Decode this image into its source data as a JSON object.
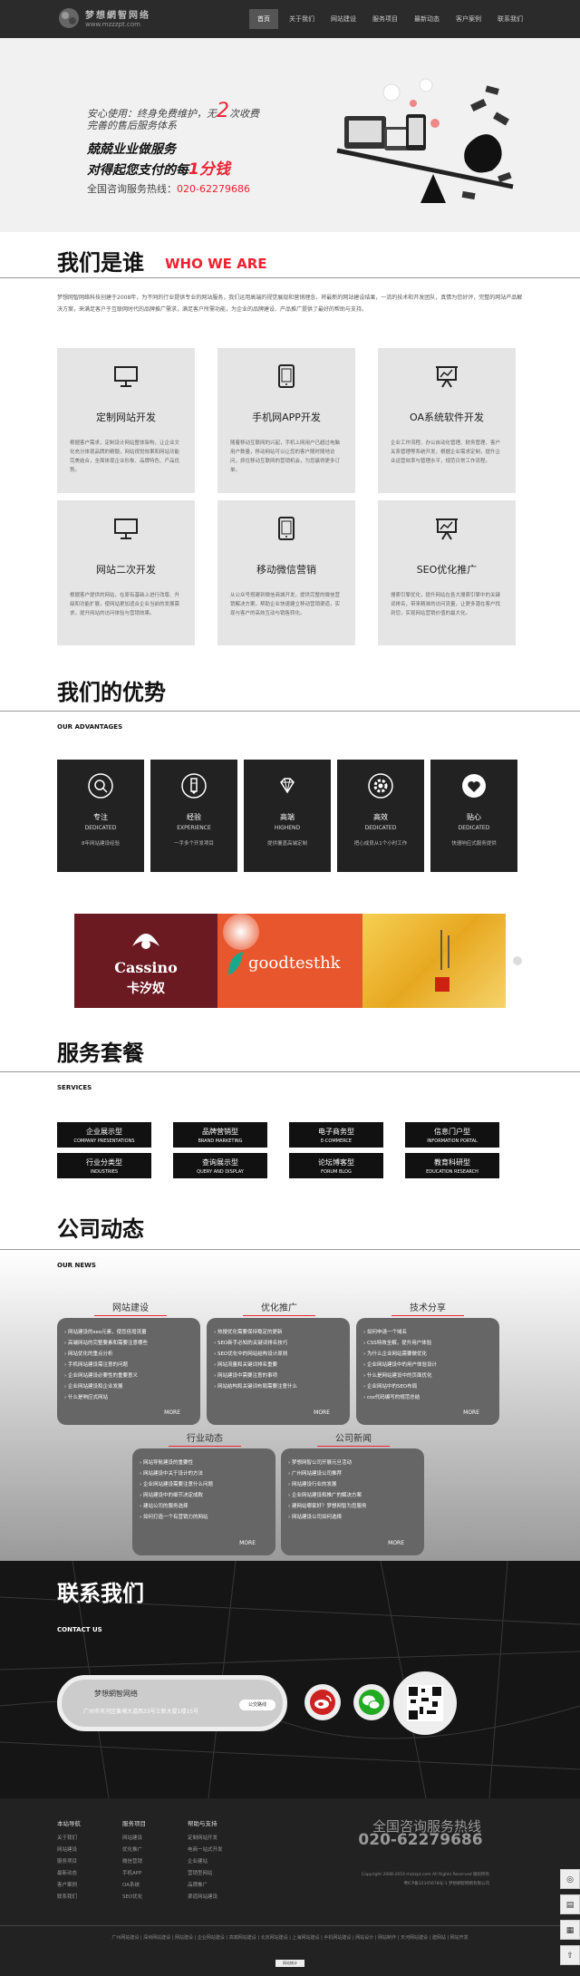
{
  "header": {
    "logo_name": "梦想網智网络",
    "logo_url": "www.mzzzpt.com",
    "nav": [
      "首页",
      "关于我们",
      "网站建设",
      "服务项目",
      "最新动态",
      "客户案例",
      "联系我们"
    ]
  },
  "banner": {
    "line1_a": "安心使用：终身免费维护，无",
    "line1_num": "2",
    "line1_b": "次收费",
    "line2": "完善的售后服务体系",
    "line3": "兢兢业业做服务",
    "line4_a": "对得起您支付的每",
    "line4_b": "1分钱",
    "line5_a": "全国咨询服务热线：",
    "line5_b": "020-62279686"
  },
  "about": {
    "title": "我们是谁",
    "title_en": "WHO WE ARE",
    "intro": "梦想网智网络科技创建于2008年，为不同的行业提供专业的网站服务，我们运用高端的视觉展现和营销理念，将最新的网站建设结果，一流的技术和开发团队，真情为您好评，完整的网站产品解决方案，来满足客户于互联网时代的品牌推广需求，满足客户所需功能，为企业的品牌建设、产品推广提供了最好的帮助与支持。"
  },
  "services": [
    {
      "title": "定制网站开发",
      "icon": "monitor-icon",
      "desc": "根据客户需求，定制设计网站整体架构，让企业文化充分体现品牌的精髓，网站视觉效果和网站功能完美结合，全面体现企业形象、品牌特色、产品优势。"
    },
    {
      "title": "手机网APP开发",
      "icon": "tablet-icon",
      "desc": "随着移动互联网的兴起，手机上网用户已超过电脑用户数量，移动网站可以让您的客户随时随地访问，抓住移动互联网的营销机会，为您赢得更多订单。"
    },
    {
      "title": "OA系统软件开发",
      "icon": "presentation-icon",
      "desc": "企业工作流程、办公自动化管理、财务管理、客户关系管理等系统开发，根据企业需求定制，提升企业运营效率与管理水平，规范日常工作流程。"
    },
    {
      "title": "网站二次开发",
      "icon": "monitor-icon",
      "desc": "根据客户提供的网站，在原有基础上进行改版、升级和功能扩展，使网站更加适合企业当前的发展需求，提升网站的访问体验与营销效果。"
    },
    {
      "title": "移动微信营销",
      "icon": "tablet-icon",
      "desc": "从公众号搭建到微信商城开发，提供完整的微信营销解决方案，帮助企业快速建立移动营销渠道，实现与客户的高效互动与销售转化。"
    },
    {
      "title": "SEO优化推广",
      "icon": "presentation-icon",
      "desc": "搜索引擎优化，提升网站在各大搜索引擎中的关键词排名，带来精准的访问流量，让更多潜在客户找到您，实现网站营销价值的最大化。"
    }
  ],
  "advantages": {
    "title": "我们的优势",
    "subtitle": "OUR ADVANTAGES",
    "items": [
      {
        "cn": "专注",
        "en": "DEDICATED",
        "desc": "8年网站建设经验",
        "icon": "search-icon"
      },
      {
        "cn": "经验",
        "en": "EXPERIENCE",
        "desc": "一手多个开发项目",
        "icon": "pen-icon"
      },
      {
        "cn": "高端",
        "en": "HIGHEND",
        "desc": "提供覆盖高端定制",
        "icon": "diamond-icon"
      },
      {
        "cn": "高效",
        "en": "DEDICATED",
        "desc": "把心成员从1个小时工作",
        "icon": "gear-icon"
      },
      {
        "cn": "贴心",
        "en": "DEDICATED",
        "desc": "快速响应式服务提供",
        "icon": "heart-icon"
      }
    ]
  },
  "cases": {
    "case1_name": "Cassino",
    "case1_cn": "卡汐奴",
    "case2_name": "goodtesthk"
  },
  "packages": {
    "title": "服务套餐",
    "subtitle": "SERVICES",
    "items": [
      {
        "cn": "企业展示型",
        "en": "COMPANY PRESENTATIONS"
      },
      {
        "cn": "品牌营销型",
        "en": "BRAND MARKETING"
      },
      {
        "cn": "电子商务型",
        "en": "E-COMMERCE"
      },
      {
        "cn": "信息门户型",
        "en": "INFORMATION PORTAL"
      },
      {
        "cn": "行业分类型",
        "en": "INDUSTRIES"
      },
      {
        "cn": "查询展示型",
        "en": "QUERY AND DISPLAY"
      },
      {
        "cn": "论坛博客型",
        "en": "FORUM BLOG"
      },
      {
        "cn": "教育科研型",
        "en": "EDUCATION RESEARCH"
      }
    ]
  },
  "news": {
    "title": "公司动态",
    "subtitle": "OUR NEWS",
    "more": "MORE",
    "groups": [
      {
        "name": "网站建设",
        "items": [
          "网站建设的seo元素，使您倍增流量",
          "高端网站的完整要素和需要注意哪些",
          "网站优化的重点分析",
          "手机网站建设需注意的问题",
          "企业网站建设必要性的重要意义",
          "企业网站建设和企业发展",
          "什么是响应式网站"
        ]
      },
      {
        "name": "优化推广",
        "items": [
          "热搜优化需要保持稳定的更新",
          "SEO新手必知的关键词排名技巧",
          "SEO优化中的网站结构设计原则",
          "网站流量和关键词排名重要",
          "网站建设中需要注意的事项",
          "网站结构和关键词布局需要注意什么"
        ]
      },
      {
        "name": "技术分享",
        "items": [
          "如何申请一个域名",
          "CSS特效全解，提升用户体验",
          "为什么企业网站需要做优化",
          "企业网站建设中的用户体验设计",
          "什么是网站建设中的页面优化",
          "企业网站中的SEO布局",
          "css代码编写的规范总结"
        ]
      },
      {
        "name": "行业动态",
        "items": [
          "网站导航建设的重要性",
          "网站建设中关于设计的方法",
          "企业网站建设需要注意什么问题",
          "网站建设中的细节决定成败",
          "建站公司的服务选择",
          "如何打造一个有营销力的网站"
        ]
      },
      {
        "name": "公司新闻",
        "items": [
          "梦想网智公司开展元旦活动",
          "广州网站建设公司推荐",
          "网站建设行业的发展",
          "企业网站建设和推广的解决方案",
          "建网站哪家好？梦想网智为您服务",
          "网站建设公司如何选择"
        ]
      }
    ]
  },
  "contact": {
    "title": "联系我们",
    "subtitle": "CONTACT US",
    "company": "梦想網智网络",
    "address": "广州市天河区黄埔大道西33号三新大厦1楼15号",
    "route": "公交路线",
    "weibo": "weibo-icon",
    "wechat": "wechat-icon"
  },
  "footer": {
    "cols": [
      {
        "head": "本站导航",
        "items": [
          "关于我们",
          "网站建设",
          "服务项目",
          "最新动态",
          "客户案例",
          "联系我们"
        ]
      },
      {
        "head": "服务项目",
        "items": [
          "网站建设",
          "优化推广",
          "微信营销",
          "手机APP",
          "OA系统",
          "SEO优化"
        ]
      },
      {
        "head": "帮助与支持",
        "items": [
          "定制网站开发",
          "电商一站式开发",
          "企业建站",
          "营销型网站",
          "品牌推广",
          "渠道网站建设"
        ]
      }
    ],
    "hotline_label": "全国咨询服务热线",
    "hotline": "020-62279686",
    "copyright": "Copyright 2008-2016 mzzzpt.com All Rights Reserved 版权所有",
    "icp": "粤ICP备12345678号-1 梦想網智网络有限公司",
    "links": "广州网站建设 | 深圳网站建设 | 网站建设 | 企业网站建设 | 高端网站建设 | 北京网站建设 | 上海网站建设 | 手机网站建设 | 网站设计 | 网站制作 | 天河网站建设 | 建网站 | 网站开发",
    "badge": "网站统计"
  }
}
